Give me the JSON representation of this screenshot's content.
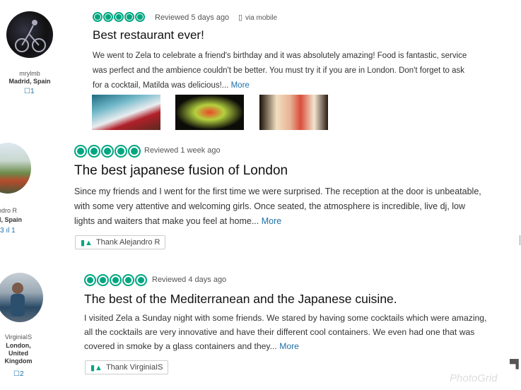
{
  "reviews": [
    {
      "reviewer": {
        "name": "mrylmb",
        "location": "Madrid, Spain",
        "counts": "☐1"
      },
      "reviewed": "Reviewed 5 days ago",
      "via": "via mobile",
      "title": "Best restaurant ever!",
      "text": "We went to Zela to celebrate a friend's birthday and it was absolutely amazing! Food is fantastic, service was perfect and the ambience couldn't be better. You must try it if you are in London. Don't forget to ask for a cocktail, Matilda was delicious!...",
      "more": "More",
      "rating": 5
    },
    {
      "reviewer": {
        "name": "andro R",
        "location": "d, Spain",
        "counts": "3 ıl 1"
      },
      "reviewed": "Reviewed 1 week ago",
      "title": "The best japanese fusion of London",
      "text": "Since my friends and I went for the first time we were surprised. The reception at the door is unbeatable, with some very attentive and welcoming girls. Once seated, the atmosphere is incredible, live dj, low lights and waiters that make you feel at home...",
      "more": "More",
      "thank": "Thank Alejandro R",
      "rating": 5
    },
    {
      "reviewer": {
        "name": "VirginiaIS",
        "location": "London, United Kingdom",
        "counts": "☐2"
      },
      "reviewed": "Reviewed 4 days ago",
      "title": "The best of the Mediterranean and the Japanese cuisine.",
      "text": "I visited Zela a Sunday night with some friends. We stared by having some cocktails which were amazing, all the cocktails are very innovative and have their different cool containers. We even had one that was covered in smoke by a glass containers and they...",
      "more": "More",
      "thank": "Thank VirginiaIS",
      "rating": 5
    }
  ],
  "watermark": "PhotoGrid",
  "colors": {
    "bubble": "#00a680",
    "link": "#1d6fa5"
  }
}
